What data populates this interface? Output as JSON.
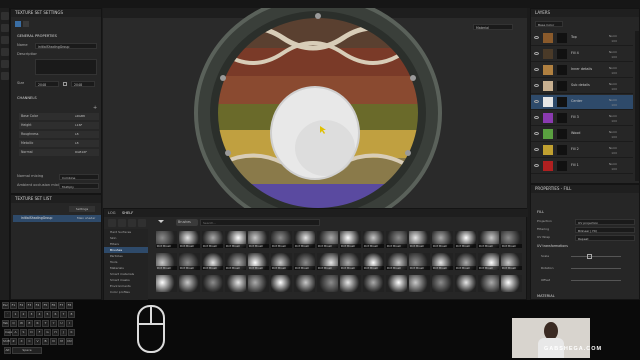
{
  "texture_set_settings": {
    "title": "TEXTURE SET SETTINGS",
    "section_general": "GENERAL PROPERTIES",
    "name_label": "Name",
    "name_value": "initialShadingGroup",
    "description_label": "Description",
    "size_label": "Size",
    "size_value": "2048",
    "size_value2": "2048",
    "channels_title": "CHANNELS",
    "channels": [
      {
        "label": "Base Color",
        "format": "sRGB8"
      },
      {
        "label": "Height",
        "format": "L16F"
      },
      {
        "label": "Roughness",
        "format": "L8"
      },
      {
        "label": "Metallic",
        "format": "L8"
      },
      {
        "label": "Normal",
        "format": "RGB16F"
      }
    ],
    "normal_mixing_label": "Normal mixing",
    "normal_mixing_value": "Combine",
    "ao_label": "Ambient occlusion mixing",
    "ao_value": "Multiply"
  },
  "texture_set_list": {
    "title": "TEXTURE SET LIST",
    "settings_button": "Settings",
    "item_name": "initialShadingGroup",
    "item_shader": "Main shader"
  },
  "viewport": {
    "mode_dropdown": "Material"
  },
  "shelf": {
    "tab_log": "LOG",
    "tab_shelf": "SHELF",
    "filter_chip": "Brushes",
    "search_placeholder": "Search...",
    "categories": [
      "Hard Surfaces",
      "Skin",
      "Filters",
      "Brushes",
      "Particles",
      "Tools",
      "Materials",
      "Smart materials",
      "Smart masks",
      "Environments",
      "Color profiles"
    ],
    "selected_category": "Brushes",
    "thumb_label": "Dirt Brush"
  },
  "layers": {
    "title": "LAYERS",
    "blend_dropdown": "Base Color",
    "items": [
      {
        "name": "Top",
        "blend": "Norm",
        "opacity": "100",
        "color": "#8a5a2b"
      },
      {
        "name": "Fill 4",
        "blend": "Norm",
        "opacity": "100",
        "color": "#4a3a28"
      },
      {
        "name": "Inner details",
        "blend": "Norm",
        "opacity": "100",
        "color": "#b08040"
      },
      {
        "name": "Sub details",
        "blend": "Norm",
        "opacity": "100",
        "color": "#c8b090"
      },
      {
        "name": "Center",
        "blend": "Norm",
        "opacity": "100",
        "color": "#e6e6e6"
      },
      {
        "name": "Fill 3",
        "blend": "Norm",
        "opacity": "100",
        "color": "#8a3ab0"
      },
      {
        "name": "Wood",
        "blend": "Norm",
        "opacity": "100",
        "color": "#5aa040"
      },
      {
        "name": "Fill 2",
        "blend": "Norm",
        "opacity": "100",
        "color": "#c0a030"
      },
      {
        "name": "Fill 1",
        "blend": "Norm",
        "opacity": "100",
        "color": "#b02020"
      }
    ],
    "selected_index": 4
  },
  "properties": {
    "title": "PROPERTIES - FILL",
    "fill_section": "FILL",
    "projection_label": "Projection",
    "projection_value": "UV projection",
    "filtering_label": "Filtering",
    "filtering_value": "Bilinear | HQ",
    "uvwrap_label": "UV Wrap",
    "uvwrap_value": "Repeat",
    "uv_transform": "UV transformations",
    "scale_label": "Scale",
    "rotation_label": "Rotation",
    "offset_label": "Offset",
    "material_section": "MATERIAL"
  },
  "watermark": "GABSHEGA.COM",
  "keyboard_keys": [
    "Esc",
    "F1",
    "F2",
    "F3",
    "F4",
    "F5",
    "F6",
    "F7",
    "F8",
    "`",
    "1",
    "2",
    "3",
    "4",
    "5",
    "6",
    "7",
    "8",
    "Tab",
    "Q",
    "W",
    "E",
    "R",
    "T",
    "Y",
    "U",
    "I",
    "Caps",
    "A",
    "S",
    "D",
    "F",
    "G",
    "H",
    "J",
    "K",
    "Shift",
    "Z",
    "X",
    "C",
    "V",
    "B",
    "N",
    "M",
    "Ctrl",
    "Alt",
    "Space"
  ]
}
